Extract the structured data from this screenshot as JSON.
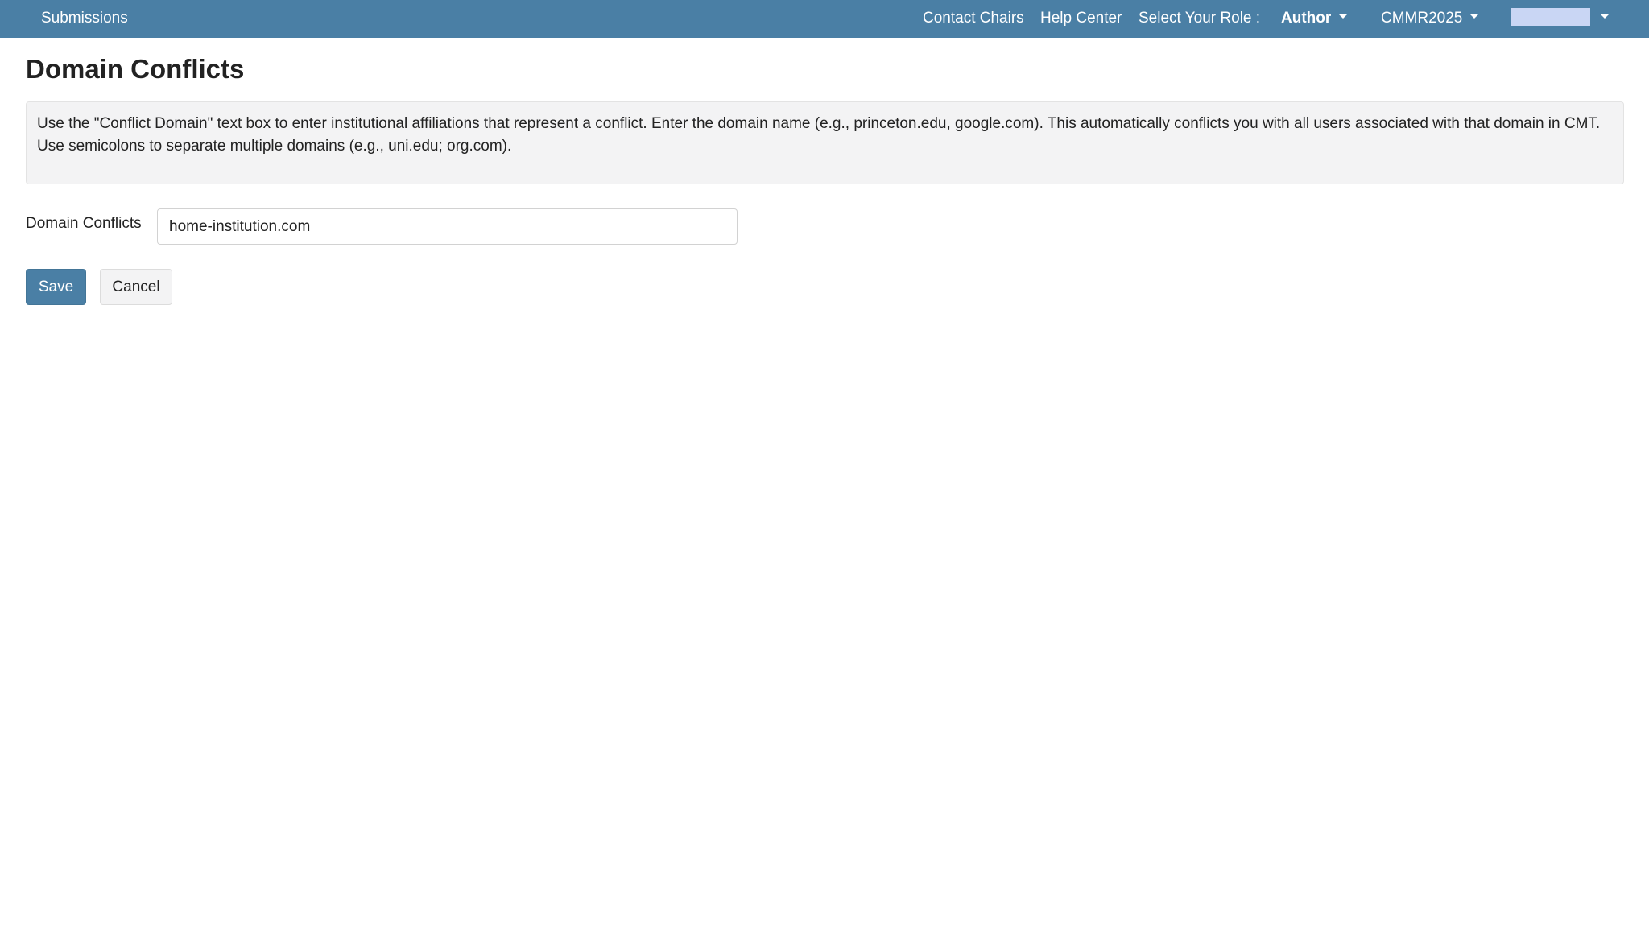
{
  "nav": {
    "submissions": "Submissions",
    "contact_chairs": "Contact Chairs",
    "help_center": "Help Center",
    "role_label": "Select Your Role :",
    "role_value": "Author",
    "conference": "CMMR2025"
  },
  "page": {
    "title": "Domain Conflicts",
    "instructions": "Use the \"Conflict Domain\" text box to enter institutional affiliations that represent a conflict. Enter the domain name (e.g., princeton.edu, google.com). This automatically conflicts you with all users associated with that domain in CMT. Use semicolons to separate multiple domains (e.g., uni.edu; org.com)."
  },
  "form": {
    "label": "Domain Conflicts",
    "value": "home-institution.com"
  },
  "buttons": {
    "save": "Save",
    "cancel": "Cancel"
  },
  "colors": {
    "brand": "#4a7fa5",
    "info_background": "#f3f3f4",
    "user_placeholder": "#c9d6f4"
  }
}
